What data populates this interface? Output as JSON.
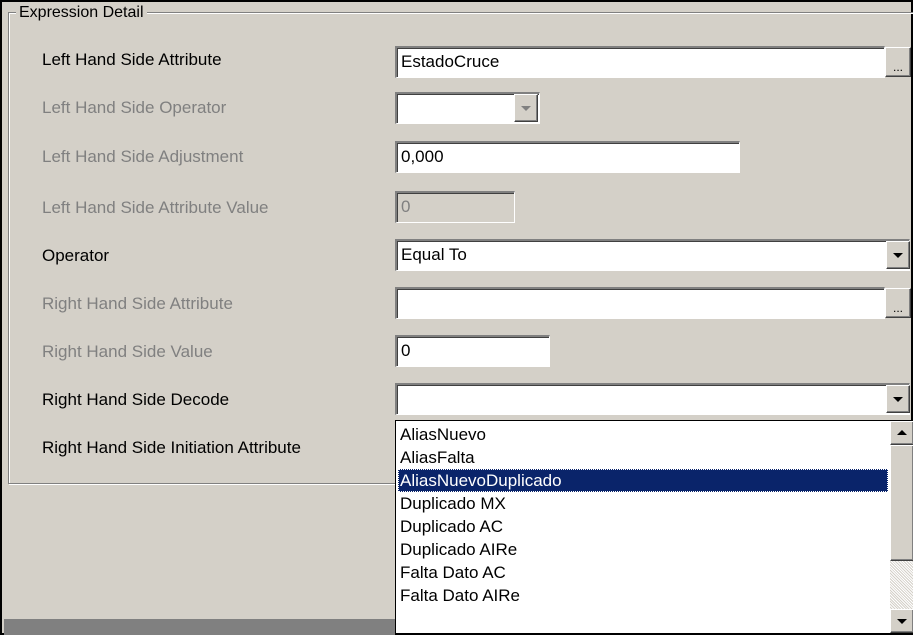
{
  "group": {
    "title": "Expression Detail"
  },
  "rows": {
    "lhs_attribute": {
      "label": "Left Hand Side Attribute",
      "value": "EstadoCruce",
      "button": "..."
    },
    "lhs_operator": {
      "label": "Left Hand Side Operator",
      "value": ""
    },
    "lhs_adjustment": {
      "label": "Left Hand Side Adjustment",
      "value": "0,000"
    },
    "lhs_attribute_value": {
      "label": "Left Hand Side Attribute Value",
      "value": "0"
    },
    "operator": {
      "label": "Operator",
      "value": "Equal To"
    },
    "rhs_attribute": {
      "label": "Right Hand Side Attribute",
      "value": "",
      "button": "..."
    },
    "rhs_value": {
      "label": "Right Hand Side Value",
      "value": "0"
    },
    "rhs_decode": {
      "label": "Right Hand Side Decode",
      "value": ""
    },
    "rhs_initiation": {
      "label": "Right Hand Side Initiation Attribute"
    }
  },
  "dropdown_list": {
    "items": [
      "AliasNuevo",
      "AliasFalta",
      "AliasNuevoDuplicado",
      "Duplicado MX",
      "Duplicado AC",
      "Duplicado AIRe",
      "Falta Dato AC",
      "Falta Dato AIRe"
    ],
    "selected_index": 2
  },
  "colors": {
    "window_bg": "#d4d0c8",
    "disabled_text": "#808080",
    "selection_bg": "#0a246a",
    "selection_text": "#ffffff"
  }
}
